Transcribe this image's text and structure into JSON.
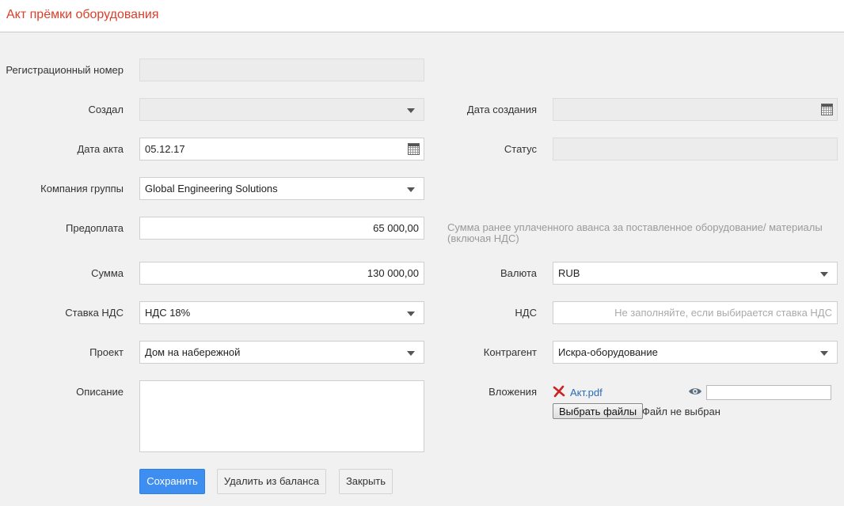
{
  "header": {
    "title": "Акт прёмки оборудования"
  },
  "form": {
    "reg_number": {
      "label": "Регистрационный номер",
      "value": ""
    },
    "created_by": {
      "label": "Создал",
      "value": ""
    },
    "created_date": {
      "label": "Дата создания",
      "value": ""
    },
    "act_date": {
      "label": "Дата акта",
      "value": "05.12.17"
    },
    "status": {
      "label": "Статус",
      "value": ""
    },
    "company": {
      "label": "Компания группы",
      "value": "Global Engineering Solutions"
    },
    "prepayment": {
      "label": "Предоплата",
      "value": "65 000,00",
      "hint": "Сумма ранее уплаченного аванса за поставленное оборудование/ материалы (включая НДС)"
    },
    "amount": {
      "label": "Сумма",
      "value": "130 000,00"
    },
    "currency": {
      "label": "Валюта",
      "value": "RUB"
    },
    "vat_rate": {
      "label": "Ставка НДС",
      "value": "НДС 18%"
    },
    "vat": {
      "label": "НДС",
      "value": "",
      "placeholder": "Не заполняйте, если выбирается ставка НДС"
    },
    "project": {
      "label": "Проект",
      "value": "Дом на набережной"
    },
    "counterparty": {
      "label": "Контрагент",
      "value": "Искра-оборудование"
    },
    "description": {
      "label": "Описание",
      "value": ""
    },
    "attachments": {
      "label": "Вложения",
      "file_name": "Акт.pdf",
      "choose_button": "Выбрать файлы",
      "no_file_text": "Файл не выбран"
    }
  },
  "actions": {
    "save": "Сохранить",
    "remove_from_balance": "Удалить из баланса",
    "close": "Закрыть"
  },
  "colors": {
    "title": "#d9402b",
    "primary_button": "#3d8ef0",
    "link": "#2a6db3",
    "delete_icon": "#cc2222"
  }
}
